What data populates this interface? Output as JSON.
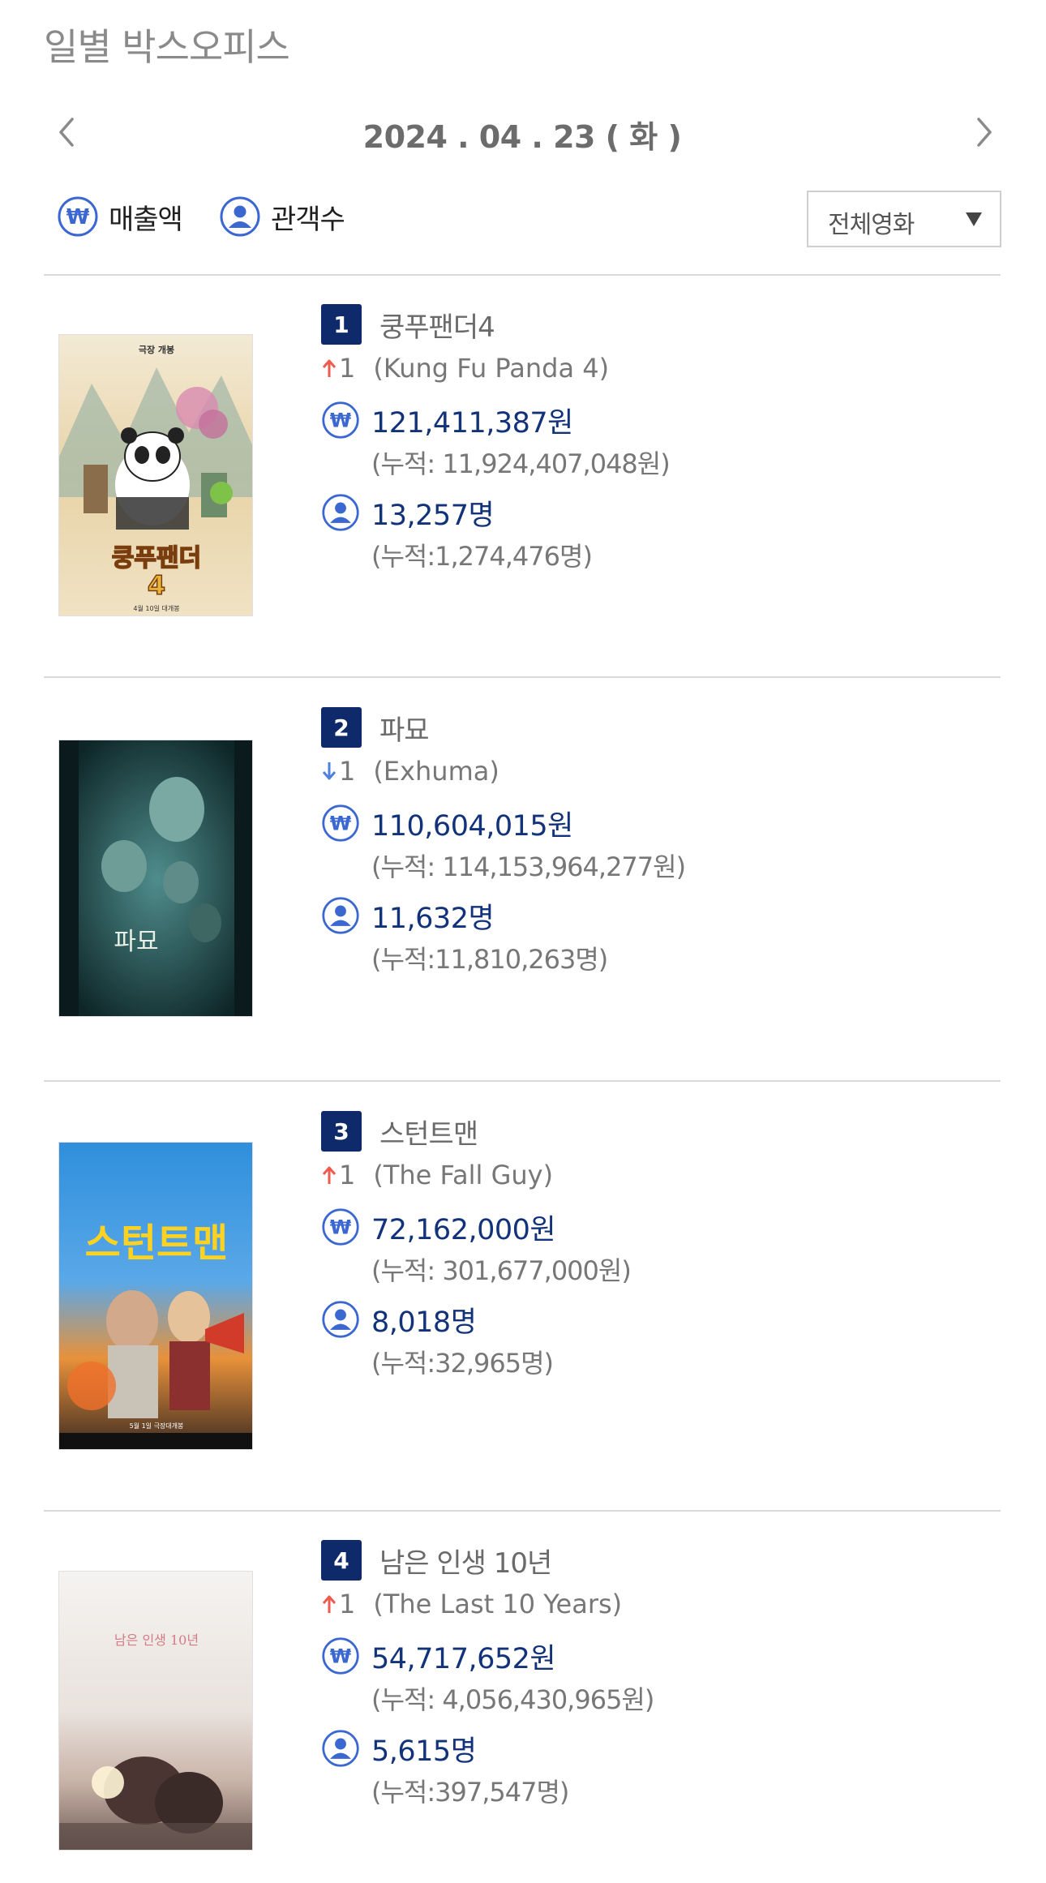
{
  "page": {
    "title": "일별 박스오피스"
  },
  "date_nav": {
    "date": "2024 . 04 . 23 ( 화 )"
  },
  "filters": {
    "revenue_label": "매출액",
    "audience_label": "관객수",
    "select_value": "전체영화"
  },
  "colors": {
    "accent_navy": "#0f2a6b",
    "icon_blue": "#3b67d1",
    "up_arrow": "#ef5a4f",
    "down_arrow": "#4f7fe0"
  },
  "movies": [
    {
      "rank": "1",
      "title_kr": "쿵푸팬더4",
      "change_dir": "up",
      "change": "1",
      "title_en": "(Kung Fu Panda 4)",
      "revenue": "121,411,387원",
      "revenue_cum": "(누적: 11,924,407,048원)",
      "audience": "13,257명",
      "audience_cum": "(누적:1,274,476명)",
      "poster_text_top": "극장 개봉",
      "poster_text_main": "쿵푸팬더",
      "poster_text_num": "4",
      "poster_text_bottom": "4월 10일 대개봉"
    },
    {
      "rank": "2",
      "title_kr": "파묘",
      "change_dir": "down",
      "change": "1",
      "title_en": "(Exhuma)",
      "revenue": "110,604,015원",
      "revenue_cum": "(누적: 114,153,964,277원)",
      "audience": "11,632명",
      "audience_cum": "(누적:11,810,263명)",
      "poster_text_main": "파묘"
    },
    {
      "rank": "3",
      "title_kr": "스턴트맨",
      "change_dir": "up",
      "change": "1",
      "title_en": "(The Fall Guy)",
      "revenue": "72,162,000원",
      "revenue_cum": "(누적: 301,677,000원)",
      "audience": "8,018명",
      "audience_cum": "(누적:32,965명)",
      "poster_text_main": "스턴트맨",
      "poster_text_bottom": "5월 1일 극장대개봉"
    },
    {
      "rank": "4",
      "title_kr": "남은 인생 10년",
      "change_dir": "up",
      "change": "1",
      "title_en": "(The Last 10 Years)",
      "revenue": "54,717,652원",
      "revenue_cum": "(누적: 4,056,430,965원)",
      "audience": "5,615명",
      "audience_cum": "(누적:397,547명)",
      "poster_text_main": "남은 인생 10년"
    }
  ]
}
